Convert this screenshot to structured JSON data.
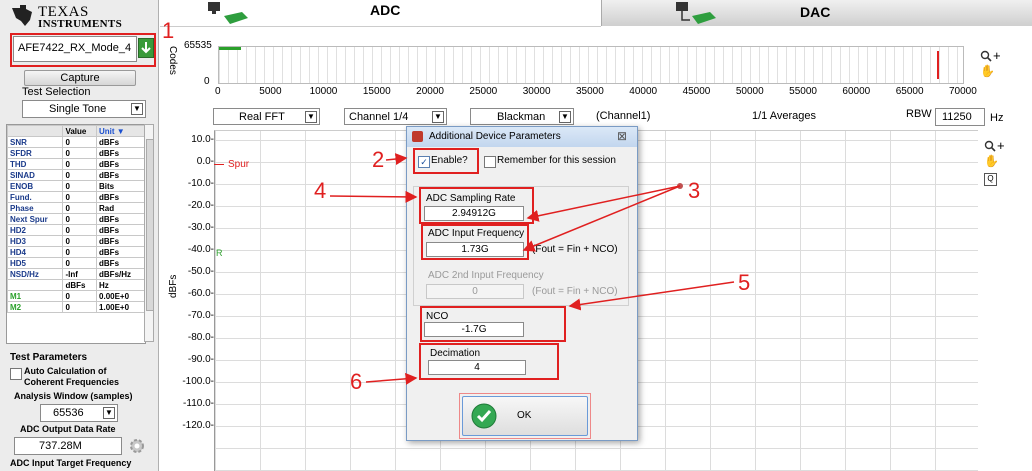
{
  "brand": {
    "line1": "TEXAS",
    "line2": "INSTRUMENTS"
  },
  "device": {
    "value": "AFE7422_RX_Mode_4"
  },
  "capture": {
    "label": "Capture"
  },
  "test_selection": {
    "label": "Test Selection",
    "value": "Single Tone"
  },
  "measurements": {
    "headers": [
      "",
      "Value",
      "Unit ▼"
    ],
    "rows": [
      [
        "SNR",
        "0",
        "dBFs"
      ],
      [
        "SFDR",
        "0",
        "dBFs"
      ],
      [
        "THD",
        "0",
        "dBFs"
      ],
      [
        "SINAD",
        "0",
        "dBFs"
      ],
      [
        "ENOB",
        "0",
        "Bits"
      ],
      [
        "Fund.",
        "0",
        "dBFs"
      ],
      [
        "Phase",
        "0",
        "Rad"
      ],
      [
        "Next Spur",
        "0",
        "dBFs"
      ],
      [
        "HD2",
        "0",
        "dBFs"
      ],
      [
        "HD3",
        "0",
        "dBFs"
      ],
      [
        "HD4",
        "0",
        "dBFs"
      ],
      [
        "HD5",
        "0",
        "dBFs"
      ],
      [
        "NSD/Hz",
        "-Inf",
        "dBFs/Hz"
      ],
      [
        "",
        "dBFs",
        "Hz"
      ],
      [
        "M1",
        "0",
        "0.00E+0"
      ],
      [
        "M2",
        "0",
        "1.00E+0"
      ]
    ]
  },
  "test_params": {
    "title": "Test Parameters",
    "auto_calc_line1": "Auto Calculation of",
    "auto_calc_line2": "Coherent Frequencies",
    "analysis_window_label": "Analysis Window (samples)",
    "analysis_window_value": "65536",
    "output_rate_label": "ADC Output Data Rate",
    "output_rate_value": "737.28M",
    "input_target_label": "ADC Input Target Frequency"
  },
  "tabs": {
    "adc": "ADC",
    "dac": "DAC"
  },
  "codes_chart": {
    "ylabel": "Codes",
    "ymax": "65535",
    "ymin": "0",
    "xticks": [
      "0",
      "5000",
      "10000",
      "15000",
      "20000",
      "25000",
      "30000",
      "35000",
      "40000",
      "45000",
      "50000",
      "55000",
      "60000",
      "65000",
      "70000"
    ]
  },
  "controls": {
    "fft": "Real FFT",
    "channel": "Channel 1/4",
    "window": "Blackman",
    "channel_label": "(Channel1)",
    "averages": "1/1 Averages",
    "rbw_label": "RBW",
    "rbw_value": "11250",
    "rbw_unit": "Hz"
  },
  "spectrum": {
    "ylabel": "dBFs",
    "yticks": [
      "10.0",
      "0.0",
      "-10.0",
      "-20.0",
      "-30.0",
      "-40.0",
      "-50.0",
      "-60.0",
      "-70.0",
      "-80.0",
      "-90.0",
      "-100.0",
      "-110.0",
      "-120.0"
    ],
    "spur": "Spur",
    "marker": "R"
  },
  "dialog": {
    "title": "Additional Device Parameters",
    "close": "⊠",
    "enable": "Enable?",
    "remember": "Remember for this session",
    "sampling_label": "ADC Sampling Rate",
    "sampling_value": "2.94912G",
    "input_freq_label": "ADC Input  Frequency",
    "input_freq_value": "1.73G",
    "fout_note": "(Fout = Fin + NCO)",
    "input2_label": "ADC 2nd Input  Frequency",
    "input2_value": "0",
    "fout_note2": "(Fout = Fin + NCO)",
    "nco_label": "NCO",
    "nco_value": "-1.7G",
    "decimation_label": "Decimation",
    "decimation_value": "4",
    "ok": "OK"
  },
  "annotations": {
    "a1": "1",
    "a2": "2",
    "a3": "3",
    "a4": "4",
    "a5": "5",
    "a6": "6"
  },
  "colors": {
    "annotation_red": "#e02020",
    "ti_red": "#cc0000",
    "grid": "#d9d9d9",
    "dialog_title_bg": "#cfe0f4",
    "ok_green": "#34a853"
  }
}
